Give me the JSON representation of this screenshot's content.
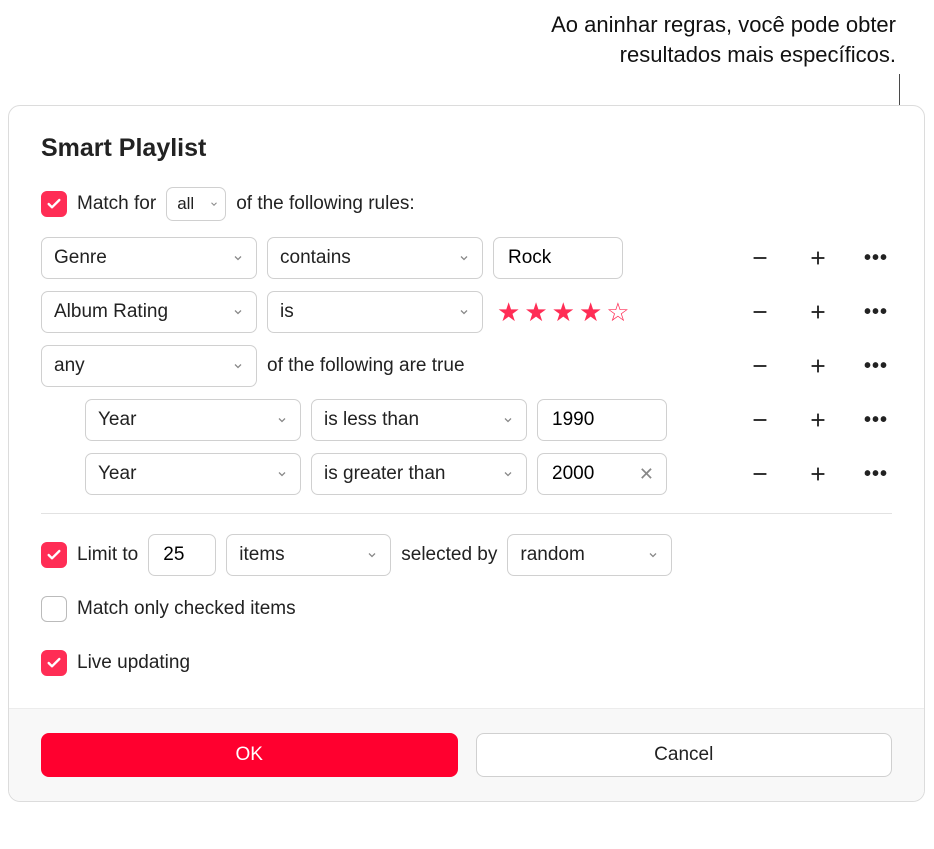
{
  "callout": {
    "line1": "Ao aninhar regras, você pode obter",
    "line2": "resultados mais específicos."
  },
  "dialog": {
    "title": "Smart Playlist",
    "matchRow": {
      "checked": true,
      "prefix": "Match  for",
      "mode": "all",
      "suffix": "of the following rules:"
    },
    "rules": [
      {
        "field": "Genre",
        "op": "contains",
        "value": "Rock"
      },
      {
        "field": "Album Rating",
        "op": "is",
        "stars": 4,
        "maxStars": 5
      }
    ],
    "group": {
      "mode": "any",
      "suffix": "of the following are true",
      "rules": [
        {
          "field": "Year",
          "op": "is less than",
          "value": "1990"
        },
        {
          "field": "Year",
          "op": "is greater than",
          "value": "2000",
          "showClear": true
        }
      ]
    },
    "limit": {
      "checked": true,
      "prefix": "Limit to",
      "count": "25",
      "unit": "items",
      "byLabel": "selected by",
      "by": "random"
    },
    "matchOnlyChecked": {
      "checked": false,
      "label": "Match only checked items"
    },
    "liveUpdating": {
      "checked": true,
      "label": "Live updating"
    },
    "buttons": {
      "ok": "OK",
      "cancel": "Cancel"
    }
  }
}
